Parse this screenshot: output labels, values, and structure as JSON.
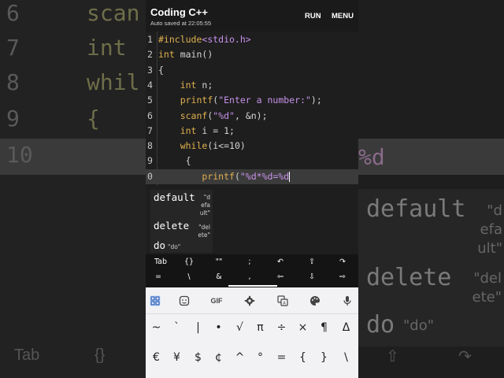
{
  "app": {
    "title": "Coding C++",
    "subtitle": "Auto saved at 22:05:55",
    "run_label": "RUN",
    "menu_label": "MENU"
  },
  "editor": {
    "line_numbers": [
      "1",
      "2",
      "3",
      "4",
      "5",
      "6",
      "7",
      "8",
      "9",
      "0"
    ],
    "lines": [
      [
        {
          "t": "#include",
          "c": "pp"
        },
        {
          "t": "<stdio.h>",
          "c": "inc"
        }
      ],
      [
        {
          "t": "int",
          "c": "kw"
        },
        {
          "t": " main()",
          "c": "plain"
        }
      ],
      [
        {
          "t": "{",
          "c": "plain"
        }
      ],
      [
        {
          "t": "    ",
          "c": "plain"
        },
        {
          "t": "int",
          "c": "kw"
        },
        {
          "t": " n;",
          "c": "plain"
        }
      ],
      [
        {
          "t": "    ",
          "c": "plain"
        },
        {
          "t": "printf",
          "c": "fn"
        },
        {
          "t": "(",
          "c": "plain"
        },
        {
          "t": "\"Enter a number:\"",
          "c": "str"
        },
        {
          "t": ");",
          "c": "plain"
        }
      ],
      [
        {
          "t": "    ",
          "c": "plain"
        },
        {
          "t": "scanf",
          "c": "fn"
        },
        {
          "t": "(",
          "c": "plain"
        },
        {
          "t": "\"%d\"",
          "c": "str"
        },
        {
          "t": ", &n);",
          "c": "plain"
        }
      ],
      [
        {
          "t": "    ",
          "c": "plain"
        },
        {
          "t": "int",
          "c": "kw"
        },
        {
          "t": " i = 1;",
          "c": "plain"
        }
      ],
      [
        {
          "t": "    ",
          "c": "plain"
        },
        {
          "t": "while",
          "c": "kw"
        },
        {
          "t": "(i<=10)",
          "c": "plain"
        }
      ],
      [
        {
          "t": "     {",
          "c": "plain"
        }
      ],
      [
        {
          "t": "        ",
          "c": "plain"
        },
        {
          "t": "printf",
          "c": "fn"
        },
        {
          "t": "(",
          "c": "plain"
        },
        {
          "t": "\"%d*%d=%d",
          "c": "str"
        }
      ]
    ],
    "current_line_index": 9
  },
  "autocomplete": {
    "items": [
      {
        "label": "default",
        "hint": [
          "\"d",
          "efa",
          "ult\""
        ]
      },
      {
        "label": "delete",
        "hint": [
          "\"del",
          "ete\""
        ]
      },
      {
        "label": "do",
        "hint": [
          "\"do\""
        ]
      }
    ]
  },
  "symbar": {
    "row1": [
      "Tab",
      "{}",
      "\"\"",
      ";",
      "↶",
      "⇧",
      "↷"
    ],
    "row2": [
      "=",
      "\\",
      "&",
      ",",
      "⇦",
      "⇩",
      "⇨"
    ]
  },
  "keyboard": {
    "toolbar_icons": [
      "apps-grid-icon",
      "sticker-icon",
      "gif-icon",
      "settings-icon",
      "translate-icon",
      "palette-icon",
      "microphone-icon"
    ],
    "gif_label": "GIF",
    "row1": [
      "~",
      "`",
      "|",
      "•",
      "√",
      "π",
      "÷",
      "×",
      "¶",
      "Δ"
    ],
    "row2": [
      "€",
      "¥",
      "$",
      "¢",
      "^",
      "°",
      "=",
      "{",
      "}",
      "\\"
    ]
  },
  "background": {
    "line_numbers": [
      "6",
      "7",
      "8",
      "9",
      "10"
    ],
    "code_fragments": [
      "scan",
      "int",
      "whil",
      "{"
    ],
    "highlight_fragment": "%d",
    "suggestions": [
      {
        "label": "default",
        "hint": [
          "\"d",
          "efa",
          "ult\""
        ]
      },
      {
        "label": "delete",
        "hint": [
          "\"del",
          "ete\""
        ]
      },
      {
        "label": "do",
        "hint": [
          "\"do\""
        ]
      }
    ],
    "bottom_labels": [
      "Tab",
      "{}",
      "⇧",
      "↷"
    ]
  }
}
